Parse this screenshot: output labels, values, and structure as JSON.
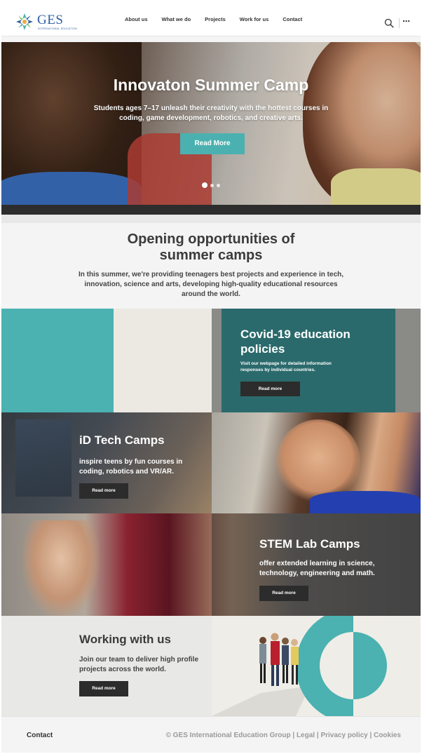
{
  "header": {
    "logo_text": "GES",
    "logo_subtext": "INTERNATIONAL EDUCATION",
    "nav": [
      "About us",
      "What we do",
      "Projects",
      "Work for us",
      "Contact"
    ],
    "more_icon": "⋯"
  },
  "hero": {
    "title": "Innovaton Summer Camp",
    "description": "Students ages 7–17 unleash their creativity with the hottest courses in coding, game development, robotics, and creative arts.",
    "button": "Read More",
    "slides": 3,
    "active_slide": 1
  },
  "intro": {
    "title": "Opening opportunities of summer camps",
    "text": "In this summer, we're providing teenagers best projects and experience in tech, innovation, science and arts, developing high-quality educational resources around the world."
  },
  "covid": {
    "title": "Covid-19 education policies",
    "text": "Visit our webpage for detailed information responses by individual countries.",
    "button": "Read more"
  },
  "idtech": {
    "title": "iD Tech Camps",
    "text": "inspire teens by fun courses in coding, robotics and VR/AR.",
    "button": "Read more"
  },
  "stem": {
    "title": "STEM Lab Camps",
    "text": "offer extended learning in science, technology, engineering and math.",
    "button": "Read more"
  },
  "work": {
    "title": "Working with us",
    "text": "Join our team to deliver high profile projects across the world.",
    "button": "Read more"
  },
  "footer": {
    "contact": "Contact",
    "copyright": "© GES International Education Group",
    "separator": "|",
    "legal": "Legal",
    "privacy": "Privacy policy",
    "cookies": "Cookies"
  },
  "colors": {
    "accent_teal": "#4bb1b0",
    "dark_teal": "#2b6a6c",
    "dark_button": "#2c2c2c"
  }
}
